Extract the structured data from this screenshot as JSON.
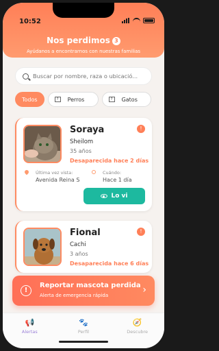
{
  "status": {
    "time": "10:52"
  },
  "header": {
    "title": "Nos perdimos",
    "count": "3",
    "subtitle": "Ayúdanos a encontrarnos con nuestras familias"
  },
  "search": {
    "placeholder": "Buscar por nombre, raza o ubicació..."
  },
  "filters": [
    {
      "label": "Todos",
      "active": true
    },
    {
      "label": "Perros",
      "active": false
    },
    {
      "label": "Gatos",
      "active": false
    }
  ],
  "pets": [
    {
      "name": "Soraya",
      "breed": "Sheilom",
      "age": "35 años",
      "lost_text": "Desaparecida hace 2 días",
      "last_seen_label": "Última vez vista:",
      "last_seen_value": "Avenida Reina S",
      "when_label": "Cuándo:",
      "when_value": "Hace 1 día",
      "action": "Lo vi"
    },
    {
      "name": "Fional",
      "breed": "Cachi",
      "age": "3 años",
      "lost_text": "Desaparecida hace 6 días"
    }
  ],
  "report": {
    "title": "Reportar mascota perdida",
    "subtitle": "Alerta de emergencia rápida"
  },
  "tabs": [
    {
      "label": "Alertas",
      "icon": "megaphone-icon",
      "active": true
    },
    {
      "label": "Perfil",
      "icon": "paw-icon",
      "active": false
    },
    {
      "label": "Descubre",
      "icon": "compass-icon",
      "active": false
    }
  ],
  "colors": {
    "accent": "#ff7f57",
    "button": "#1db99f",
    "tab_active": "#9a80d8"
  }
}
